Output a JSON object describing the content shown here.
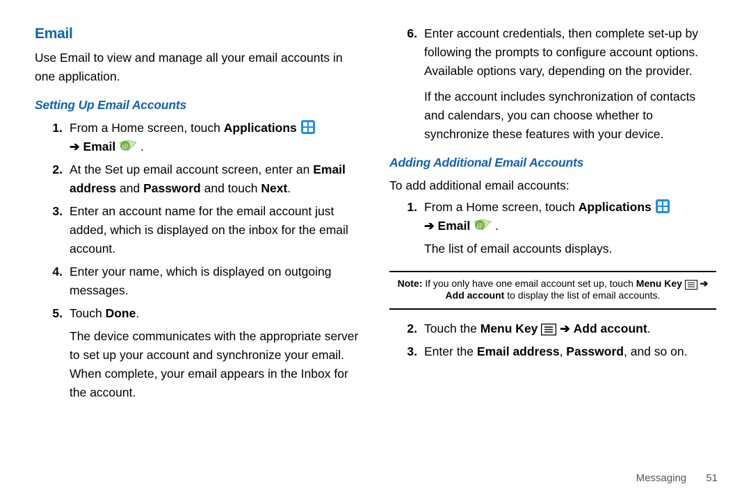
{
  "left": {
    "emailTitle": "Email",
    "emailIntro": "Use Email to view and manage all your email accounts in one application.",
    "setupHeading": "Setting Up Email Accounts",
    "step1_a": "From a Home screen, touch ",
    "step1_apps": "Applications",
    "step1_arrow": "➔",
    "step1_email": " Email ",
    "step1_dot": " .",
    "step2_a": "At the Set up email account screen, enter an ",
    "step2_b": "Email address",
    "step2_c": " and ",
    "step2_d": "Password",
    "step2_e": " and touch ",
    "step2_f": "Next",
    "step2_g": ".",
    "step3": "Enter an account name for the email account just added, which is displayed on the inbox for the email account.",
    "step4": "Enter your name, which is displayed on outgoing messages.",
    "step5_a": "Touch ",
    "step5_b": "Done",
    "step5_c": ".",
    "step5_body": "The device communicates with the appropriate server to set up your account and synchronize your email. When complete, your email appears in the Inbox for the account."
  },
  "right": {
    "step6_num": "6.",
    "step6": "Enter account credentials, then complete set-up by following the prompts to configure account options. Available options vary, depending on the provider.",
    "step6_body": "If the account includes synchronization of contacts and calendars, you can choose whether to synchronize these features with your device.",
    "additionalHeading": "Adding Additional Email Accounts",
    "additionalIntro": "To add additional email accounts:",
    "a1_a": "From a Home screen, touch ",
    "a1_apps": "Applications",
    "a1_arrow": "➔",
    "a1_email": " Email ",
    "a1_dot": " .",
    "a1_body": "The list of email accounts displays.",
    "note_a": "Note:",
    "note_b": " If you only have one email account set up, touch ",
    "note_c": "Menu Key",
    "note_arrow": " ➔ ",
    "note_d": "Add account",
    "note_e": " to display the list of email accounts.",
    "a2_a": "Touch the ",
    "a2_b": "Menu Key",
    "a2_arrow": " ➔ ",
    "a2_c": "Add account",
    "a2_d": ".",
    "a3_a": "Enter the ",
    "a3_b": "Email address",
    "a3_c": ", ",
    "a3_d": "Password",
    "a3_e": ", and so on."
  },
  "footer": {
    "section": "Messaging",
    "page": "51"
  }
}
